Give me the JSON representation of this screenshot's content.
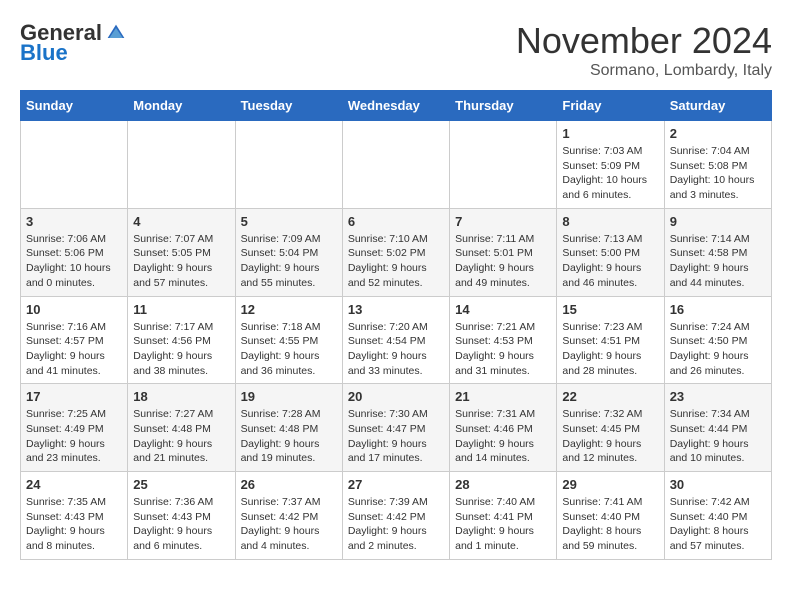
{
  "logo": {
    "general": "General",
    "blue": "Blue"
  },
  "title": "November 2024",
  "location": "Sormano, Lombardy, Italy",
  "days_of_week": [
    "Sunday",
    "Monday",
    "Tuesday",
    "Wednesday",
    "Thursday",
    "Friday",
    "Saturday"
  ],
  "weeks": [
    [
      {
        "day": "",
        "info": ""
      },
      {
        "day": "",
        "info": ""
      },
      {
        "day": "",
        "info": ""
      },
      {
        "day": "",
        "info": ""
      },
      {
        "day": "",
        "info": ""
      },
      {
        "day": "1",
        "info": "Sunrise: 7:03 AM\nSunset: 5:09 PM\nDaylight: 10 hours\nand 6 minutes."
      },
      {
        "day": "2",
        "info": "Sunrise: 7:04 AM\nSunset: 5:08 PM\nDaylight: 10 hours\nand 3 minutes."
      }
    ],
    [
      {
        "day": "3",
        "info": "Sunrise: 7:06 AM\nSunset: 5:06 PM\nDaylight: 10 hours\nand 0 minutes."
      },
      {
        "day": "4",
        "info": "Sunrise: 7:07 AM\nSunset: 5:05 PM\nDaylight: 9 hours\nand 57 minutes."
      },
      {
        "day": "5",
        "info": "Sunrise: 7:09 AM\nSunset: 5:04 PM\nDaylight: 9 hours\nand 55 minutes."
      },
      {
        "day": "6",
        "info": "Sunrise: 7:10 AM\nSunset: 5:02 PM\nDaylight: 9 hours\nand 52 minutes."
      },
      {
        "day": "7",
        "info": "Sunrise: 7:11 AM\nSunset: 5:01 PM\nDaylight: 9 hours\nand 49 minutes."
      },
      {
        "day": "8",
        "info": "Sunrise: 7:13 AM\nSunset: 5:00 PM\nDaylight: 9 hours\nand 46 minutes."
      },
      {
        "day": "9",
        "info": "Sunrise: 7:14 AM\nSunset: 4:58 PM\nDaylight: 9 hours\nand 44 minutes."
      }
    ],
    [
      {
        "day": "10",
        "info": "Sunrise: 7:16 AM\nSunset: 4:57 PM\nDaylight: 9 hours\nand 41 minutes."
      },
      {
        "day": "11",
        "info": "Sunrise: 7:17 AM\nSunset: 4:56 PM\nDaylight: 9 hours\nand 38 minutes."
      },
      {
        "day": "12",
        "info": "Sunrise: 7:18 AM\nSunset: 4:55 PM\nDaylight: 9 hours\nand 36 minutes."
      },
      {
        "day": "13",
        "info": "Sunrise: 7:20 AM\nSunset: 4:54 PM\nDaylight: 9 hours\nand 33 minutes."
      },
      {
        "day": "14",
        "info": "Sunrise: 7:21 AM\nSunset: 4:53 PM\nDaylight: 9 hours\nand 31 minutes."
      },
      {
        "day": "15",
        "info": "Sunrise: 7:23 AM\nSunset: 4:51 PM\nDaylight: 9 hours\nand 28 minutes."
      },
      {
        "day": "16",
        "info": "Sunrise: 7:24 AM\nSunset: 4:50 PM\nDaylight: 9 hours\nand 26 minutes."
      }
    ],
    [
      {
        "day": "17",
        "info": "Sunrise: 7:25 AM\nSunset: 4:49 PM\nDaylight: 9 hours\nand 23 minutes."
      },
      {
        "day": "18",
        "info": "Sunrise: 7:27 AM\nSunset: 4:48 PM\nDaylight: 9 hours\nand 21 minutes."
      },
      {
        "day": "19",
        "info": "Sunrise: 7:28 AM\nSunset: 4:48 PM\nDaylight: 9 hours\nand 19 minutes."
      },
      {
        "day": "20",
        "info": "Sunrise: 7:30 AM\nSunset: 4:47 PM\nDaylight: 9 hours\nand 17 minutes."
      },
      {
        "day": "21",
        "info": "Sunrise: 7:31 AM\nSunset: 4:46 PM\nDaylight: 9 hours\nand 14 minutes."
      },
      {
        "day": "22",
        "info": "Sunrise: 7:32 AM\nSunset: 4:45 PM\nDaylight: 9 hours\nand 12 minutes."
      },
      {
        "day": "23",
        "info": "Sunrise: 7:34 AM\nSunset: 4:44 PM\nDaylight: 9 hours\nand 10 minutes."
      }
    ],
    [
      {
        "day": "24",
        "info": "Sunrise: 7:35 AM\nSunset: 4:43 PM\nDaylight: 9 hours\nand 8 minutes."
      },
      {
        "day": "25",
        "info": "Sunrise: 7:36 AM\nSunset: 4:43 PM\nDaylight: 9 hours\nand 6 minutes."
      },
      {
        "day": "26",
        "info": "Sunrise: 7:37 AM\nSunset: 4:42 PM\nDaylight: 9 hours\nand 4 minutes."
      },
      {
        "day": "27",
        "info": "Sunrise: 7:39 AM\nSunset: 4:42 PM\nDaylight: 9 hours\nand 2 minutes."
      },
      {
        "day": "28",
        "info": "Sunrise: 7:40 AM\nSunset: 4:41 PM\nDaylight: 9 hours\nand 1 minute."
      },
      {
        "day": "29",
        "info": "Sunrise: 7:41 AM\nSunset: 4:40 PM\nDaylight: 8 hours\nand 59 minutes."
      },
      {
        "day": "30",
        "info": "Sunrise: 7:42 AM\nSunset: 4:40 PM\nDaylight: 8 hours\nand 57 minutes."
      }
    ]
  ]
}
